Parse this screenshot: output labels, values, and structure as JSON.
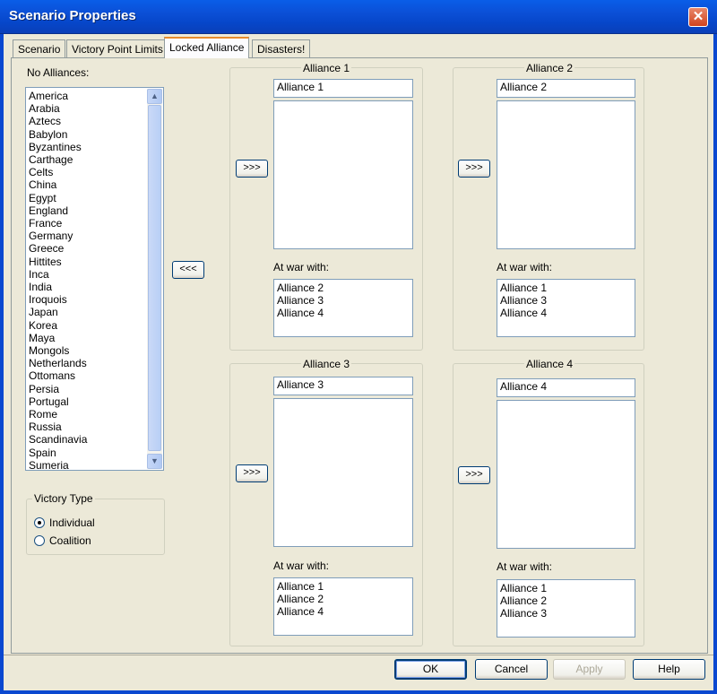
{
  "window": {
    "title": "Scenario Properties",
    "close_glyph": "✕"
  },
  "tabs": [
    {
      "label": "Scenario",
      "active": false
    },
    {
      "label": "Victory Point Limits",
      "active": false
    },
    {
      "label": "Locked Alliance",
      "active": true
    },
    {
      "label": "Disasters!",
      "active": false
    }
  ],
  "no_alliances": {
    "label": "No Alliances:",
    "items": [
      "America",
      "Arabia",
      "Aztecs",
      "Babylon",
      "Byzantines",
      "Carthage",
      "Celts",
      "China",
      "Egypt",
      "England",
      "France",
      "Germany",
      "Greece",
      "Hittites",
      "Inca",
      "India",
      "Iroquois",
      "Japan",
      "Korea",
      "Maya",
      "Mongols",
      "Netherlands",
      "Ottomans",
      "Persia",
      "Portugal",
      "Rome",
      "Russia",
      "Scandinavia",
      "Spain",
      "Sumeria"
    ],
    "remove_button": "<<<"
  },
  "victory_type": {
    "title": "Victory Type",
    "options": [
      {
        "label": "Individual",
        "checked": true
      },
      {
        "label": "Coalition",
        "checked": false
      }
    ]
  },
  "alliances": [
    {
      "title": "Alliance 1",
      "name": "Alliance 1",
      "add_button": ">>>",
      "at_war_label": "At war with:",
      "at_war": [
        "Alliance 2",
        "Alliance 3",
        "Alliance 4"
      ]
    },
    {
      "title": "Alliance 2",
      "name": "Alliance 2",
      "add_button": ">>>",
      "at_war_label": "At war with:",
      "at_war": [
        "Alliance 1",
        "Alliance 3",
        "Alliance 4"
      ]
    },
    {
      "title": "Alliance 3",
      "name": "Alliance 3",
      "add_button": ">>>",
      "at_war_label": "At war with:",
      "at_war": [
        "Alliance 1",
        "Alliance 2",
        "Alliance 4"
      ]
    },
    {
      "title": "Alliance 4",
      "name": "Alliance 4",
      "add_button": ">>>",
      "at_war_label": "At war with:",
      "at_war": [
        "Alliance 1",
        "Alliance 2",
        "Alliance 3"
      ]
    }
  ],
  "footer": {
    "ok": "OK",
    "cancel": "Cancel",
    "apply": "Apply",
    "help": "Help"
  },
  "icons": {
    "scroll_up": "chevron-up-icon",
    "scroll_down": "chevron-down-icon"
  }
}
